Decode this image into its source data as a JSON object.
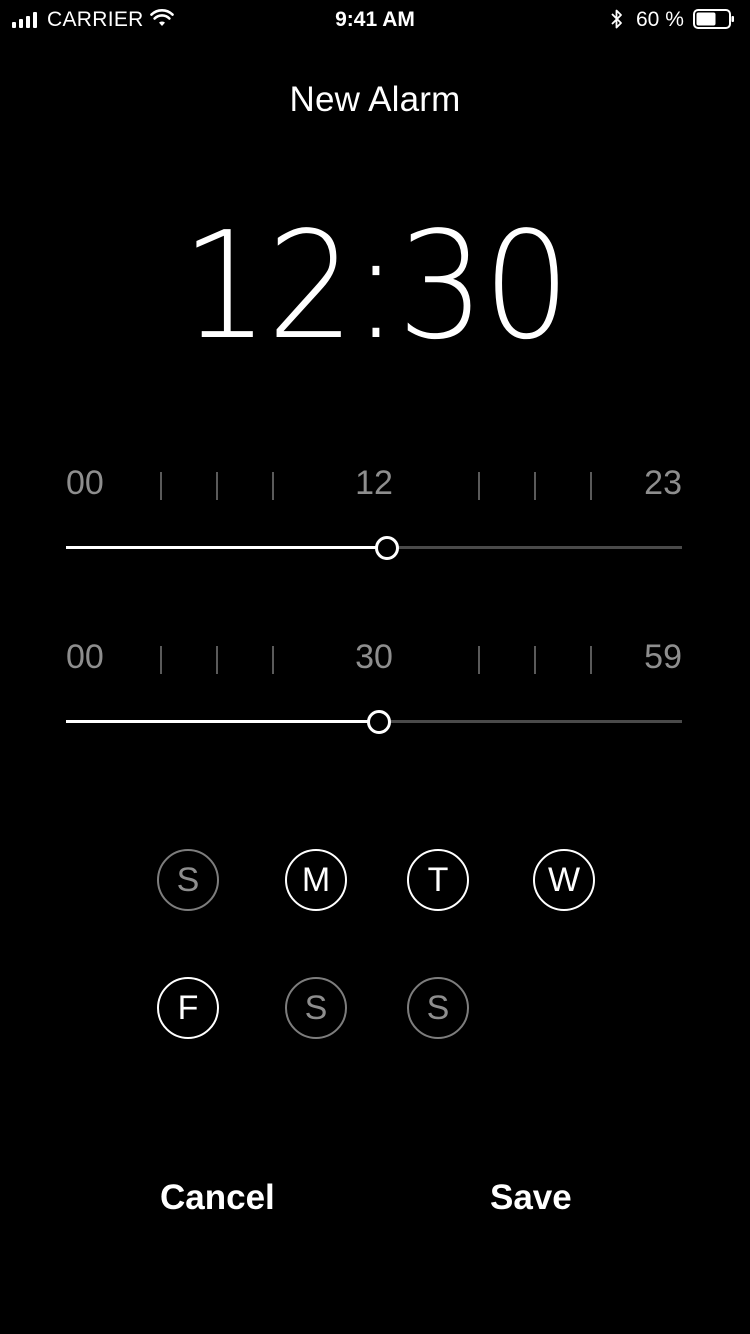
{
  "status_bar": {
    "carrier": "CARRIER",
    "time": "9:41 AM",
    "battery_percent": "60 %",
    "icons": [
      "signal-icon",
      "wifi-icon",
      "bluetooth-icon",
      "battery-icon"
    ]
  },
  "header": {
    "title": "New Alarm"
  },
  "time_display": "12:30",
  "hour_slider": {
    "min_label": "00",
    "mid_label": "12",
    "max_label": "23",
    "min": 0,
    "max": 23,
    "value": 12
  },
  "minute_slider": {
    "min_label": "00",
    "mid_label": "30",
    "max_label": "59",
    "min": 0,
    "max": 59,
    "value": 30
  },
  "days": [
    {
      "label": "S",
      "active": false
    },
    {
      "label": "M",
      "active": true
    },
    {
      "label": "T",
      "active": true
    },
    {
      "label": "W",
      "active": true
    },
    {
      "label": "F",
      "active": true
    },
    {
      "label": "S",
      "active": false
    },
    {
      "label": "S",
      "active": false
    }
  ],
  "actions": {
    "cancel_label": "Cancel",
    "save_label": "Save"
  },
  "colors": {
    "background": "#000000",
    "active": "#ffffff",
    "inactive": "#8e8e8e",
    "track": "#4a4a4a"
  }
}
